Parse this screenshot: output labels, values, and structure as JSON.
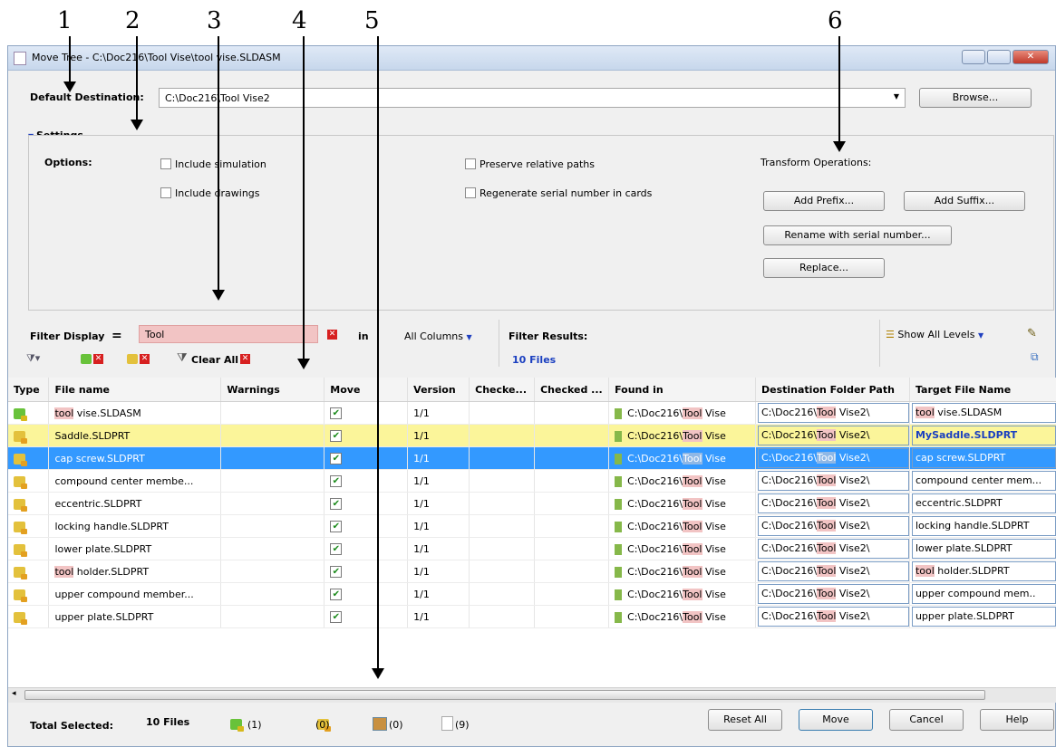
{
  "callouts": [
    "1",
    "2",
    "3",
    "4",
    "5",
    "6"
  ],
  "window": {
    "title": "Move Tree - C:\\Doc216\\Tool Vise\\tool vise.SLDASM"
  },
  "destination": {
    "label": "Default Destination:",
    "value": "C:\\Doc216\\Tool Vise2",
    "browse": "Browse..."
  },
  "settings": {
    "header": "Settings",
    "options_label": "Options:",
    "include_simulation": "Include simulation",
    "include_drawings": "Include drawings",
    "preserve_paths": "Preserve relative paths",
    "regen_serial": "Regenerate serial number in cards"
  },
  "transform": {
    "label": "Transform Operations:",
    "add_prefix": "Add Prefix...",
    "add_suffix": "Add Suffix...",
    "rename_serial": "Rename with serial number...",
    "replace": "Replace..."
  },
  "filter": {
    "label": "Filter Display",
    "equals": "=",
    "value": "Tool",
    "in": "in",
    "columns": "All Columns",
    "results_label": "Filter Results:",
    "results_value": "10 Files",
    "clear_all": "Clear All",
    "show_levels": "Show All Levels"
  },
  "table": {
    "headers": [
      "Type",
      "File name",
      "Warnings",
      "Move",
      "Version",
      "Checke...",
      "Checked ...",
      "Found in",
      "Destination Folder Path",
      "Target File Name"
    ],
    "rows": [
      {
        "pre": "",
        "hl": "tool",
        "post": " vise.SLDASM",
        "version": "1/1",
        "found": "Tool",
        "target_hl": "tool",
        "target": " vise.SLDASM"
      },
      {
        "pre": "Saddle.SLDPRT",
        "hl": "",
        "post": "",
        "version": "1/1",
        "found": "Tool",
        "target_hl": "",
        "target": "MySaddle.SLDPRT"
      },
      {
        "pre": "cap screw.SLDPRT",
        "hl": "",
        "post": "",
        "version": "1/1",
        "found": "Tool",
        "target_hl": "",
        "target": "cap screw.SLDPRT"
      },
      {
        "pre": "compound center membe...",
        "hl": "",
        "post": "",
        "version": "1/1",
        "found": "Tool",
        "target_hl": "",
        "target": "compound center mem..."
      },
      {
        "pre": "eccentric.SLDPRT",
        "hl": "",
        "post": "",
        "version": "1/1",
        "found": "Tool",
        "target_hl": "",
        "target": "eccentric.SLDPRT"
      },
      {
        "pre": "locking handle.SLDPRT",
        "hl": "",
        "post": "",
        "version": "1/1",
        "found": "Tool",
        "target_hl": "",
        "target": "locking handle.SLDPRT"
      },
      {
        "pre": "lower plate.SLDPRT",
        "hl": "",
        "post": "",
        "version": "1/1",
        "found": "Tool",
        "target_hl": "",
        "target": "lower plate.SLDPRT"
      },
      {
        "pre": "",
        "hl": "tool",
        "post": " holder.SLDPRT",
        "version": "1/1",
        "found": "Tool",
        "target_hl": "tool",
        "target": " holder.SLDPRT"
      },
      {
        "pre": "upper compound member...",
        "hl": "",
        "post": "",
        "version": "1/1",
        "found": "Tool",
        "target_hl": "",
        "target": "upper compound mem.."
      },
      {
        "pre": "upper plate.SLDPRT",
        "hl": "",
        "post": "",
        "version": "1/1",
        "found": "Tool",
        "target_hl": "",
        "target": "upper plate.SLDPRT"
      }
    ],
    "found_prefix": "C:\\Doc216\\",
    "found_suffix": " Vise",
    "dest_prefix": "C:\\Doc216\\",
    "dest_hl": "Tool",
    "dest_suffix": " Vise2\\"
  },
  "footer": {
    "total_label": "Total Selected:",
    "total_value": "10 Files",
    "c1": "(1)",
    "c2": "(0)",
    "c3": "(0)",
    "c4": "(9)",
    "reset": "Reset All",
    "move": "Move",
    "cancel": "Cancel",
    "help": "Help"
  }
}
